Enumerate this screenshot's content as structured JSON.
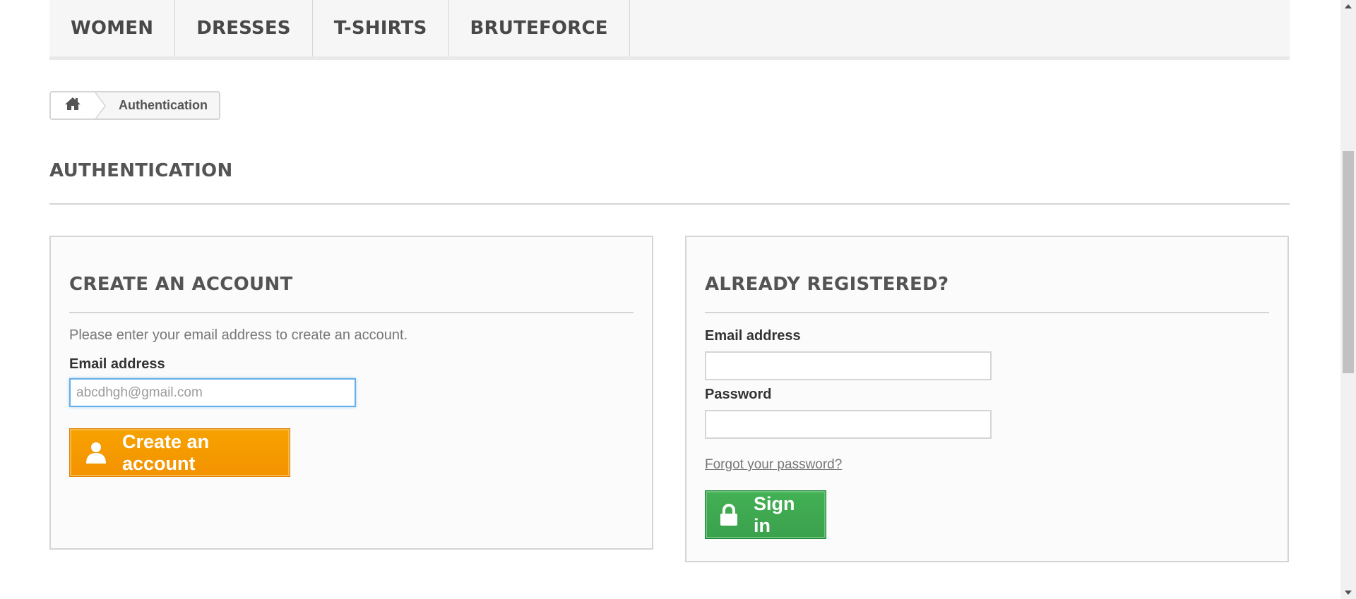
{
  "topmenu": {
    "items": [
      "WOMEN",
      "DRESSES",
      "T-SHIRTS",
      "BRUTEFORCE"
    ]
  },
  "breadcrumb": {
    "home_icon": "home-icon",
    "current": "Authentication"
  },
  "page": {
    "heading": "AUTHENTICATION"
  },
  "create_account": {
    "title": "CREATE AN ACCOUNT",
    "help_text": "Please enter your email address to create an account.",
    "email_label": "Email address",
    "email_value": "abcdhgh@gmail.com",
    "button_label": "Create an account",
    "button_icon": "user-icon",
    "button_color": "#f39200"
  },
  "login": {
    "title": "ALREADY REGISTERED?",
    "email_label": "Email address",
    "email_value": "",
    "password_label": "Password",
    "password_value": "",
    "forgot_link": "Forgot your password?",
    "button_label": "Sign in",
    "button_icon": "lock-icon",
    "button_color": "#3aa04c"
  }
}
